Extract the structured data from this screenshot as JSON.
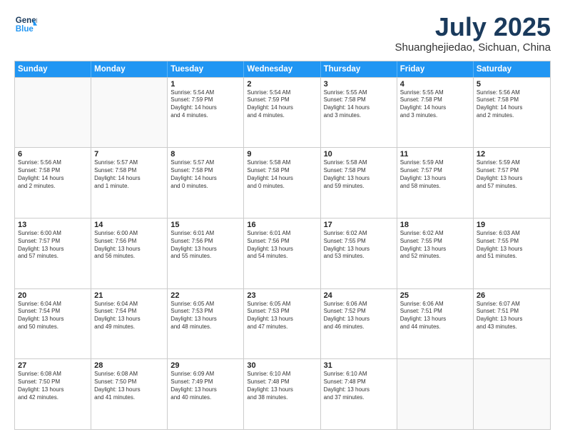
{
  "header": {
    "logo_line1": "General",
    "logo_line2": "Blue",
    "month_title": "July 2025",
    "location": "Shuanghejiedao, Sichuan, China"
  },
  "weekdays": [
    "Sunday",
    "Monday",
    "Tuesday",
    "Wednesday",
    "Thursday",
    "Friday",
    "Saturday"
  ],
  "rows": [
    [
      {
        "day": "",
        "info": ""
      },
      {
        "day": "",
        "info": ""
      },
      {
        "day": "1",
        "info": "Sunrise: 5:54 AM\nSunset: 7:59 PM\nDaylight: 14 hours\nand 4 minutes."
      },
      {
        "day": "2",
        "info": "Sunrise: 5:54 AM\nSunset: 7:59 PM\nDaylight: 14 hours\nand 4 minutes."
      },
      {
        "day": "3",
        "info": "Sunrise: 5:55 AM\nSunset: 7:58 PM\nDaylight: 14 hours\nand 3 minutes."
      },
      {
        "day": "4",
        "info": "Sunrise: 5:55 AM\nSunset: 7:58 PM\nDaylight: 14 hours\nand 3 minutes."
      },
      {
        "day": "5",
        "info": "Sunrise: 5:56 AM\nSunset: 7:58 PM\nDaylight: 14 hours\nand 2 minutes."
      }
    ],
    [
      {
        "day": "6",
        "info": "Sunrise: 5:56 AM\nSunset: 7:58 PM\nDaylight: 14 hours\nand 2 minutes."
      },
      {
        "day": "7",
        "info": "Sunrise: 5:57 AM\nSunset: 7:58 PM\nDaylight: 14 hours\nand 1 minute."
      },
      {
        "day": "8",
        "info": "Sunrise: 5:57 AM\nSunset: 7:58 PM\nDaylight: 14 hours\nand 0 minutes."
      },
      {
        "day": "9",
        "info": "Sunrise: 5:58 AM\nSunset: 7:58 PM\nDaylight: 14 hours\nand 0 minutes."
      },
      {
        "day": "10",
        "info": "Sunrise: 5:58 AM\nSunset: 7:58 PM\nDaylight: 13 hours\nand 59 minutes."
      },
      {
        "day": "11",
        "info": "Sunrise: 5:59 AM\nSunset: 7:57 PM\nDaylight: 13 hours\nand 58 minutes."
      },
      {
        "day": "12",
        "info": "Sunrise: 5:59 AM\nSunset: 7:57 PM\nDaylight: 13 hours\nand 57 minutes."
      }
    ],
    [
      {
        "day": "13",
        "info": "Sunrise: 6:00 AM\nSunset: 7:57 PM\nDaylight: 13 hours\nand 57 minutes."
      },
      {
        "day": "14",
        "info": "Sunrise: 6:00 AM\nSunset: 7:56 PM\nDaylight: 13 hours\nand 56 minutes."
      },
      {
        "day": "15",
        "info": "Sunrise: 6:01 AM\nSunset: 7:56 PM\nDaylight: 13 hours\nand 55 minutes."
      },
      {
        "day": "16",
        "info": "Sunrise: 6:01 AM\nSunset: 7:56 PM\nDaylight: 13 hours\nand 54 minutes."
      },
      {
        "day": "17",
        "info": "Sunrise: 6:02 AM\nSunset: 7:55 PM\nDaylight: 13 hours\nand 53 minutes."
      },
      {
        "day": "18",
        "info": "Sunrise: 6:02 AM\nSunset: 7:55 PM\nDaylight: 13 hours\nand 52 minutes."
      },
      {
        "day": "19",
        "info": "Sunrise: 6:03 AM\nSunset: 7:55 PM\nDaylight: 13 hours\nand 51 minutes."
      }
    ],
    [
      {
        "day": "20",
        "info": "Sunrise: 6:04 AM\nSunset: 7:54 PM\nDaylight: 13 hours\nand 50 minutes."
      },
      {
        "day": "21",
        "info": "Sunrise: 6:04 AM\nSunset: 7:54 PM\nDaylight: 13 hours\nand 49 minutes."
      },
      {
        "day": "22",
        "info": "Sunrise: 6:05 AM\nSunset: 7:53 PM\nDaylight: 13 hours\nand 48 minutes."
      },
      {
        "day": "23",
        "info": "Sunrise: 6:05 AM\nSunset: 7:53 PM\nDaylight: 13 hours\nand 47 minutes."
      },
      {
        "day": "24",
        "info": "Sunrise: 6:06 AM\nSunset: 7:52 PM\nDaylight: 13 hours\nand 46 minutes."
      },
      {
        "day": "25",
        "info": "Sunrise: 6:06 AM\nSunset: 7:51 PM\nDaylight: 13 hours\nand 44 minutes."
      },
      {
        "day": "26",
        "info": "Sunrise: 6:07 AM\nSunset: 7:51 PM\nDaylight: 13 hours\nand 43 minutes."
      }
    ],
    [
      {
        "day": "27",
        "info": "Sunrise: 6:08 AM\nSunset: 7:50 PM\nDaylight: 13 hours\nand 42 minutes."
      },
      {
        "day": "28",
        "info": "Sunrise: 6:08 AM\nSunset: 7:50 PM\nDaylight: 13 hours\nand 41 minutes."
      },
      {
        "day": "29",
        "info": "Sunrise: 6:09 AM\nSunset: 7:49 PM\nDaylight: 13 hours\nand 40 minutes."
      },
      {
        "day": "30",
        "info": "Sunrise: 6:10 AM\nSunset: 7:48 PM\nDaylight: 13 hours\nand 38 minutes."
      },
      {
        "day": "31",
        "info": "Sunrise: 6:10 AM\nSunset: 7:48 PM\nDaylight: 13 hours\nand 37 minutes."
      },
      {
        "day": "",
        "info": ""
      },
      {
        "day": "",
        "info": ""
      }
    ]
  ]
}
